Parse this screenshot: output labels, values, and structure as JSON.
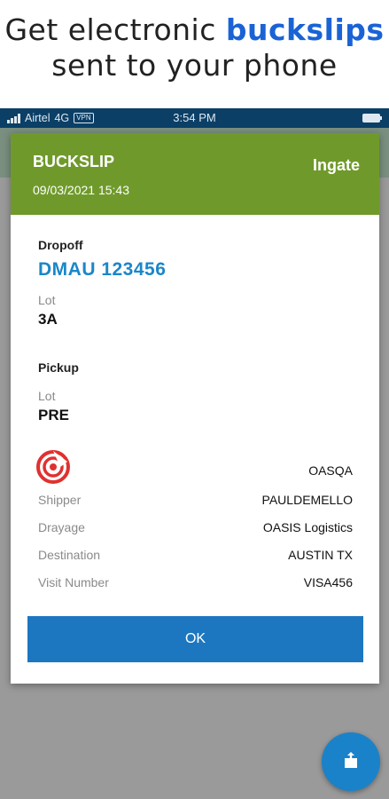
{
  "promo": {
    "line1_prefix": "Get electronic ",
    "line1_accent": "buckslips",
    "line2": "sent to your phone"
  },
  "status_bar": {
    "carrier": "Airtel",
    "network": "4G",
    "vpn": "VPN",
    "time": "3:54 PM"
  },
  "dialog": {
    "title": "BUCKSLIP",
    "datetime": "09/03/2021 15:43",
    "status": "Ingate",
    "dropoff": {
      "label": "Dropoff",
      "container": "DMAU 123456",
      "lot_label": "Lot",
      "lot_value": "3A"
    },
    "pickup": {
      "label": "Pickup",
      "lot_label": "Lot",
      "lot_value": "PRE"
    },
    "company_code": "OASQA",
    "details": [
      {
        "label": "Shipper",
        "value": "PAULDEMELLO"
      },
      {
        "label": "Drayage",
        "value": "OASIS Logistics"
      },
      {
        "label": "Destination",
        "value": "AUSTIN TX"
      },
      {
        "label": "Visit Number",
        "value": "VISA456"
      }
    ],
    "ok_label": "OK"
  },
  "icons": {
    "logo": "company-logo-icon",
    "fab": "share-icon"
  },
  "colors": {
    "header_green": "#6f9a2b",
    "accent_blue": "#1c77c0",
    "container_blue": "#1b86c9",
    "promo_accent": "#1a63d6",
    "status_bar": "#0b3f66",
    "logo_red": "#e0312f"
  }
}
